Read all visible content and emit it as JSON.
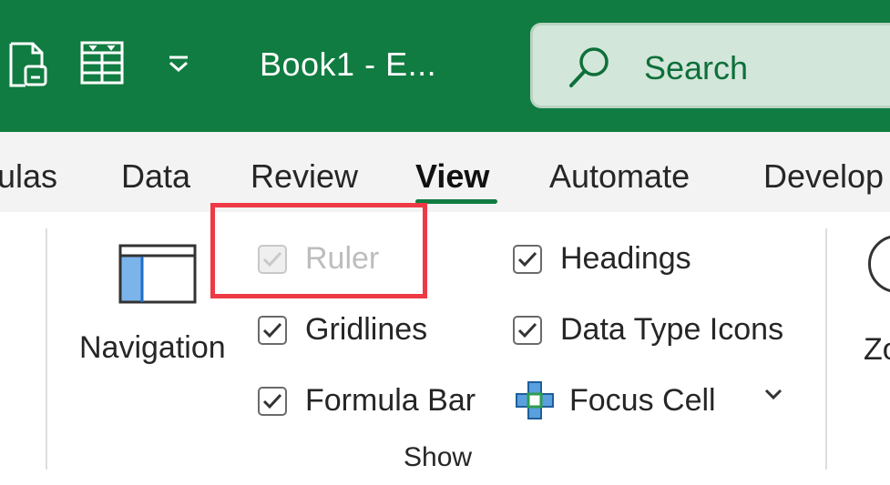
{
  "titlebar": {
    "document_title": "Book1  -  E...",
    "icons": [
      "document-clip-icon",
      "table-form-icon",
      "customize-toolbar-icon"
    ],
    "color": "#107c41"
  },
  "search": {
    "label": "Search",
    "icon": "search-icon"
  },
  "tabs": [
    {
      "label": "ulas",
      "active": false
    },
    {
      "label": "Data",
      "active": false
    },
    {
      "label": "Review",
      "active": false
    },
    {
      "label": "View",
      "active": true
    },
    {
      "label": "Automate",
      "active": false
    },
    {
      "label": "Develop",
      "active": false
    }
  ],
  "ribbon": {
    "navigation_label": "Navigation",
    "show_group": {
      "label": "Show",
      "options": {
        "ruler": {
          "label": "Ruler",
          "checked": true,
          "disabled": true
        },
        "gridlines": {
          "label": "Gridlines",
          "checked": true,
          "disabled": false
        },
        "formula_bar": {
          "label": "Formula Bar",
          "checked": true,
          "disabled": false
        },
        "headings": {
          "label": "Headings",
          "checked": true,
          "disabled": false
        },
        "data_type_icons": {
          "label": "Data Type Icons",
          "checked": true,
          "disabled": false
        },
        "focus_cell": {
          "label": "Focus Cell",
          "icon": "focus-cell-icon"
        }
      }
    },
    "zoom_label": "Zo"
  },
  "colors": {
    "accent": "#107c41",
    "highlight": "#ee3a45",
    "search_bg": "#d2e6da"
  }
}
